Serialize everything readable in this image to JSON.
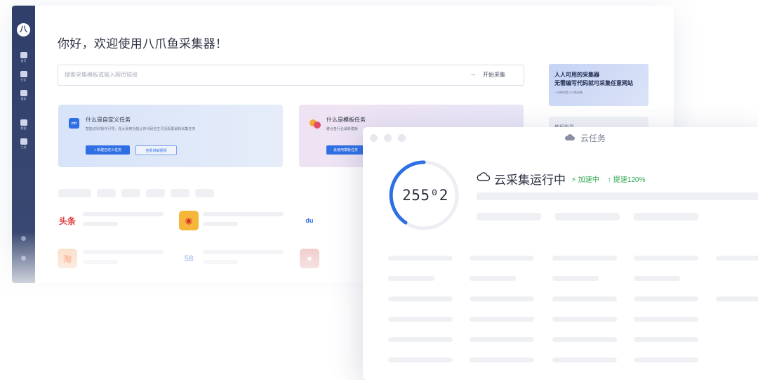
{
  "back_window": {
    "sidebar": {
      "logo_glyph": "八",
      "items": [
        {
          "label": "首页",
          "icon": "home-icon"
        },
        {
          "label": "任务",
          "icon": "task-icon"
        },
        {
          "label": "模板",
          "icon": "template-icon"
        },
        {
          "label": "数据",
          "icon": "data-icon"
        },
        {
          "label": "工具",
          "icon": "toolbox-icon"
        }
      ]
    },
    "greeting": "你好，欢迎使用八爪鱼采集器！",
    "search": {
      "placeholder": "搜索采集模板或输入网页链接",
      "button_label": "开始采集",
      "arrow": "→"
    },
    "card_custom": {
      "icon_text": "ctrl",
      "title": "什么是自定义任务",
      "desc": "智能识别/操作引导，强大易用功能让你代码自主灵活配置最新采集任务",
      "primary_btn": "+ 新建自定义任务",
      "secondary_btn": "查看讲解视频"
    },
    "card_template": {
      "title": "什么是模板任务",
      "desc": "聚合各行业最新模板",
      "primary_btn": "去使用模板任务"
    },
    "promo": {
      "line1": "人人可用的采集器",
      "line2": "无需编写代码就可采集任意网站",
      "line3": "一分钟学会八爪鱼采集"
    },
    "promo2": {
      "text": "教程指导"
    },
    "brands": [
      {
        "text": "头条",
        "color": "#e23b3b"
      },
      {
        "text": "◉",
        "color": "#e7892b"
      },
      {
        "text": "du",
        "color": "#2f6fe4"
      },
      {
        "text": "淘",
        "color": "#f26a2b"
      },
      {
        "text": "58",
        "color": "#3c6fd8"
      },
      {
        "text": "★",
        "color": "#d84a4a"
      }
    ]
  },
  "front_window": {
    "title": "云任务",
    "counter": "255⁰2",
    "status": "云采集运行中",
    "tag_accelerating": "⚡ 加速中",
    "tag_speedup": "↑ 提速120%"
  }
}
